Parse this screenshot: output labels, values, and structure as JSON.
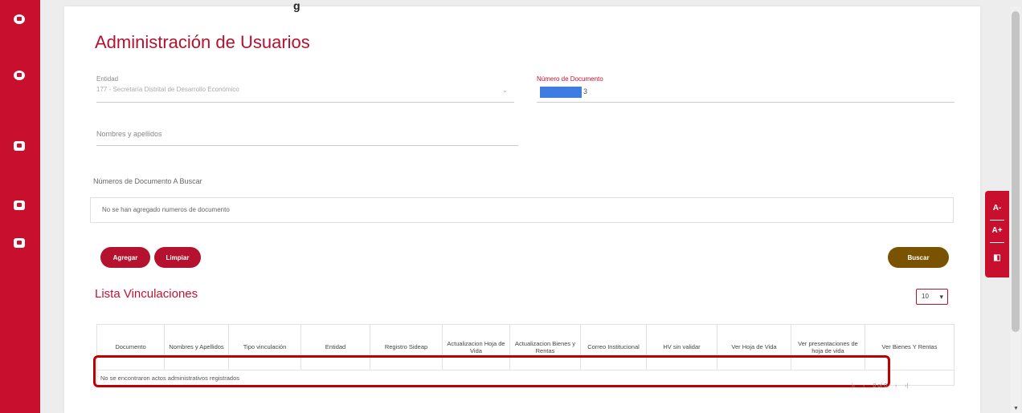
{
  "page": {
    "title": "Administración de Usuarios",
    "top_partial": "g"
  },
  "sidebar": {
    "icons": [
      "gear-icon",
      "user-icon",
      "calendar-icon",
      "calendar-icon-2",
      "document-icon"
    ]
  },
  "filters": {
    "entity": {
      "label": "Entidad",
      "value": "177 - Secretaría Distrital de Desarrollo Económico"
    },
    "document_number": {
      "label": "Número de Documento",
      "value_end": "3"
    },
    "names": {
      "placeholder": "Nombres y apellidos"
    },
    "documents_to_search": {
      "label": "Números de Documento A Buscar",
      "empty_text": "No se han agregado numeros de documento"
    }
  },
  "buttons": {
    "add": "Agregar",
    "clear": "Limpiar",
    "search": "Buscar"
  },
  "list": {
    "title": "Lista Vinculaciones",
    "page_size": "10",
    "columns": [
      "Documento",
      "Nombres y Apellidos",
      "Tipo vinculación",
      "Entidad",
      "Registro Sideap",
      "Actualizacion Hoja de Vida",
      "Actualizacion Bienes y Rentas",
      "Correo Institucional",
      "HV sin validar",
      "Ver Hoja de Vida",
      "Ver presentaciones de hoja de vida",
      "Ver Bienes Y Rentas"
    ],
    "empty_message": "No se encontraron actos administrativos registrados",
    "pagination": {
      "range": "0 of 0"
    }
  },
  "accessibility": {
    "decrease": "A-",
    "increase": "A+"
  },
  "colors": {
    "primary": "#c8102e",
    "search_button": "#7a5300",
    "highlight": "#c00000"
  }
}
